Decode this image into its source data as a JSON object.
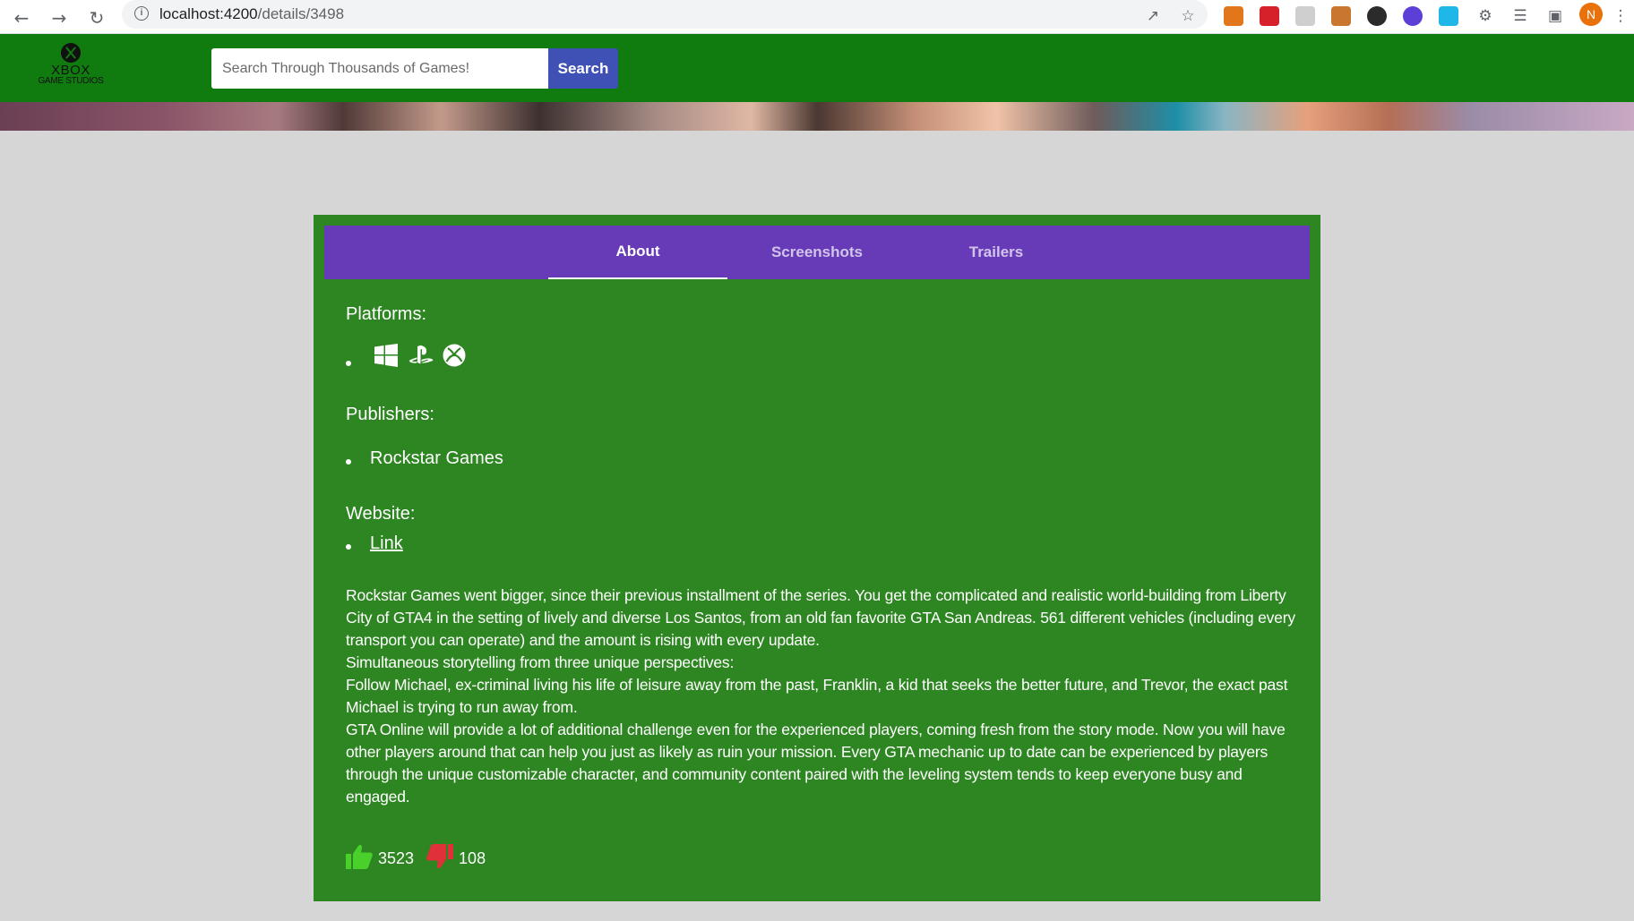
{
  "browser": {
    "url_host": "localhost:4200",
    "url_path": "/details/3498",
    "profile_initial": "N"
  },
  "header": {
    "logo_line1": "XBOX",
    "logo_line2": "GAME STUDIOS",
    "search_placeholder": "Search Through Thousands of Games!",
    "search_button": "Search"
  },
  "tabs": [
    {
      "label": "About",
      "active": true
    },
    {
      "label": "Screenshots",
      "active": false
    },
    {
      "label": "Trailers",
      "active": false
    }
  ],
  "about": {
    "platforms_label": "Platforms:",
    "platforms": [
      "windows-icon",
      "playstation-icon",
      "xbox-icon"
    ],
    "publishers_label": "Publishers:",
    "publishers": [
      "Rockstar Games"
    ],
    "website_label": "Website:",
    "website_link_text": "Link",
    "description": [
      "Rockstar Games went bigger, since their previous installment of the series. You get the complicated and realistic world-building from Liberty City of GTA4 in the setting of lively and diverse Los Santos, from an old fan favorite GTA San Andreas. 561 different vehicles (including every transport you can operate) and the amount is rising with every update.",
      "Simultaneous storytelling from three unique perspectives:",
      "Follow Michael, ex-criminal living his life of leisure away from the past, Franklin, a kid that seeks the better future, and Trevor, the exact past Michael is trying to run away from.",
      "GTA Online will provide a lot of additional challenge even for the experienced players, coming fresh from the story mode. Now you will have other players around that can help you just as likely as ruin your mission. Every GTA mechanic up to date can be experienced by players through the unique customizable character, and community content paired with the leveling system tends to keep everyone busy and engaged."
    ],
    "likes": "3523",
    "dislikes": "108"
  },
  "colors": {
    "header_green": "#107c10",
    "card_green": "#2e8622",
    "tab_purple": "#673ab7",
    "search_blue": "#3f51b5",
    "like_green": "#4ad02a",
    "dislike_red": "#e0303a"
  }
}
